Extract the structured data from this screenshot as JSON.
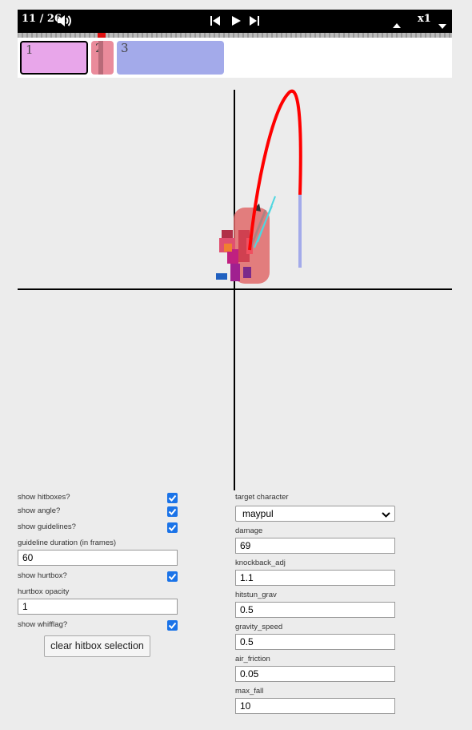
{
  "player": {
    "frame_counter": "11 / 26",
    "speed": "x1"
  },
  "windows": [
    {
      "label": "1",
      "color": "#e8a6ea",
      "selected": true
    },
    {
      "label": "2",
      "color": "#ea8b9b",
      "selected": false
    },
    {
      "label": "3",
      "color": "#a3aaea",
      "selected": false
    }
  ],
  "left_controls": {
    "show_hitboxes": {
      "label": "show hitboxes?",
      "checked": true
    },
    "show_angle": {
      "label": "show angle?",
      "checked": true
    },
    "show_guidelines": {
      "label": "show guidelines?",
      "checked": true
    },
    "guideline_duration": {
      "label": "guideline duration (in frames)",
      "value": "60"
    },
    "show_hurtbox": {
      "label": "show hurtbox?",
      "checked": true
    },
    "hurtbox_opacity": {
      "label": "hurtbox opacity",
      "value": "1"
    },
    "show_whifflag": {
      "label": "show whifflag?",
      "checked": true
    },
    "clear_button": "clear hitbox selection"
  },
  "right_controls": {
    "target_character": {
      "label": "target character",
      "value": "maypul"
    },
    "damage": {
      "label": "damage",
      "value": "69"
    },
    "knockback_adj": {
      "label": "knockback_adj",
      "value": "1.1"
    },
    "hitstun_grav": {
      "label": "hitstun_grav",
      "value": "0.5"
    },
    "gravity_speed": {
      "label": "gravity_speed",
      "value": "0.5"
    },
    "air_friction": {
      "label": "air_friction",
      "value": "0.05"
    },
    "max_fall": {
      "label": "max_fall",
      "value": "10"
    }
  },
  "colors": {
    "trajectory": "#ff0000",
    "hitstun_end": "#a3aaea",
    "hitbox": "#e06a6a",
    "checkbox": "#1a73e8"
  }
}
